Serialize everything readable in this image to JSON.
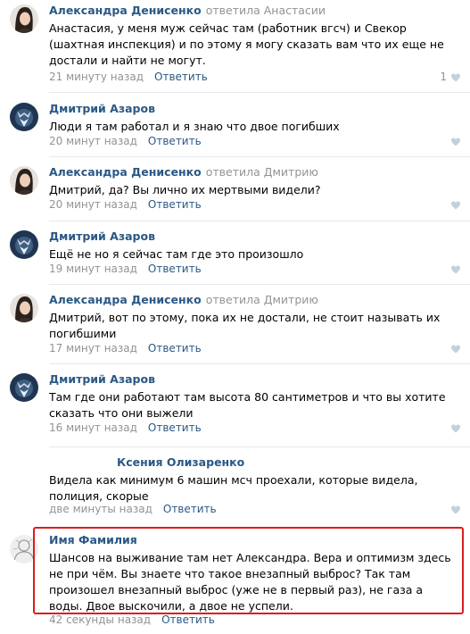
{
  "comments": [
    {
      "author": "Александра Денисенко",
      "reply_to": "ответила Анастасии",
      "text": "Анастасия, у меня муж сейчас там (работник вгсч) и Свекор (шахтная инспекция) и по этому я могу сказать вам что их еще не достали и найти не могут.",
      "time": "21 минуту назад",
      "reply": "Ответить",
      "likes": "1",
      "avatar": "woman-avatar"
    },
    {
      "author": "Дмитрий Азаров",
      "reply_to": "",
      "text": "Люди я там работал и я знаю что двое погибших",
      "time": "20 минут назад",
      "reply": "Ответить",
      "avatar": "wolf-avatar"
    },
    {
      "author": "Александра Денисенко",
      "reply_to": "ответила Дмитрию",
      "text": "Дмитрий, да? Вы лично их мертвыми видели?",
      "time": "20 минут назад",
      "reply": "Ответить",
      "avatar": "woman-avatar"
    },
    {
      "author": "Дмитрий Азаров",
      "reply_to": "",
      "text": "Ещё не но я сейчас там где это произошло",
      "time": "19 минут назад",
      "reply": "Ответить",
      "avatar": "wolf-avatar"
    },
    {
      "author": "Александра Денисенко",
      "reply_to": "ответила Дмитрию",
      "text": "Дмитрий, вот по этому, пока их не достали, не стоит называть их погибшими",
      "time": "17 минут назад",
      "reply": "Ответить",
      "avatar": "woman-avatar"
    },
    {
      "author": "Дмитрий Азаров",
      "reply_to": "",
      "text": "Там где они работают там высота 80 сантиметров и что вы хотите сказать что они выжели",
      "time": "16 минут назад",
      "reply": "Ответить",
      "avatar": "wolf-avatar"
    },
    {
      "author": "Ксения Олизаренко",
      "reply_to": "",
      "text": "Видела как минимум 6 машин мсч проехали, которые видела, полиция, скорые",
      "time": "две минуты назад",
      "reply": "Ответить",
      "avatar": "none"
    },
    {
      "author": "Имя Фамилия",
      "reply_to": "",
      "text": "Шансов на выживание там нет Александра. Вера и оптимизм здесь не при чём. Вы знаете что такое внезапный выброс? Так там произошел внезапный выброс (уже не в первый раз), не газа а воды. Двое выскочили, а двое не успели.",
      "time": "42 секунды назад",
      "reply": "Ответить",
      "avatar": "sketch-avatar"
    }
  ],
  "colors": {
    "link": "#2a5885",
    "muted": "#939393",
    "highlight_border": "#d91e1e"
  },
  "icons": {
    "like": "heart-icon"
  }
}
